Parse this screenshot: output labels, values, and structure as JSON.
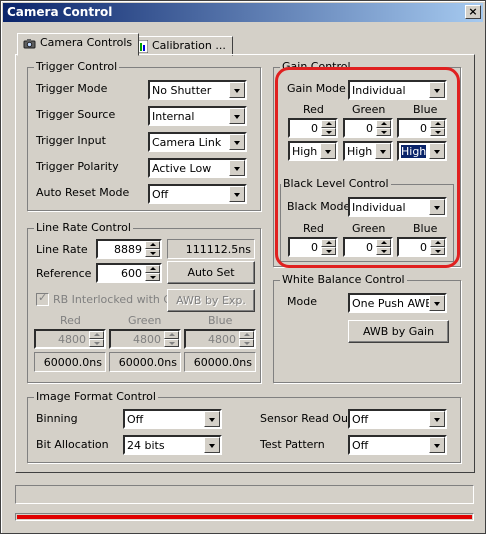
{
  "window": {
    "title": "Camera Control",
    "close_glyph": "×"
  },
  "tabs": [
    {
      "label": "Camera Controls",
      "icon": "camera-icon"
    },
    {
      "label": "Calibration ...",
      "icon": "chart-icon"
    }
  ],
  "trigger": {
    "legend": "Trigger Control",
    "mode_label": "Trigger Mode",
    "mode_value": "No Shutter",
    "source_label": "Trigger Source",
    "source_value": "Internal",
    "input_label": "Trigger Input",
    "input_value": "Camera Link",
    "polarity_label": "Trigger Polarity",
    "polarity_value": "Active Low",
    "autoreset_label": "Auto Reset Mode",
    "autoreset_value": "Off"
  },
  "gain": {
    "legend": "Gain Control",
    "mode_label": "Gain Mode",
    "mode_value": "Individual",
    "red_label": "Red",
    "green_label": "Green",
    "blue_label": "Blue",
    "red_value": "0",
    "green_value": "0",
    "blue_value": "0",
    "red_range": "High",
    "green_range": "High",
    "blue_range": "High"
  },
  "black": {
    "legend": "Black Level Control",
    "mode_label": "Black Mode",
    "mode_value": "Individual",
    "red_label": "Red",
    "green_label": "Green",
    "blue_label": "Blue",
    "red_value": "0",
    "green_value": "0",
    "blue_value": "0"
  },
  "line_rate": {
    "legend": "Line Rate Control",
    "rate_label": "Line Rate",
    "rate_value": "8889",
    "rate_readout": "111112.5ns",
    "reference_label": "Reference",
    "reference_value": "600",
    "autoset_label": "Auto Set",
    "interlock_label": "RB Interlocked with G",
    "awb_exp_label": "AWB by Exp.",
    "red_label": "Red",
    "green_label": "Green",
    "blue_label": "Blue",
    "red_value": "4800",
    "green_value": "4800",
    "blue_value": "4800",
    "red_time": "60000.0ns",
    "green_time": "60000.0ns",
    "blue_time": "60000.0ns"
  },
  "white_balance": {
    "legend": "White Balance Control",
    "mode_label": "Mode",
    "mode_value": "One Push AWB",
    "awb_gain_label": "AWB by Gain"
  },
  "image_format": {
    "legend": "Image Format Control",
    "binning_label": "Binning",
    "binning_value": "Off",
    "bit_label": "Bit Allocation",
    "bit_value": "24 bits",
    "readout_label": "Sensor Read Out",
    "readout_value": "Off",
    "pattern_label": "Test Pattern",
    "pattern_value": "Off"
  },
  "progress": {
    "value": 1.0,
    "color": "#e00000"
  },
  "colors": {
    "title_bar": "#0a246a",
    "face": "#d4d0c8",
    "annotation": "#e02020"
  }
}
